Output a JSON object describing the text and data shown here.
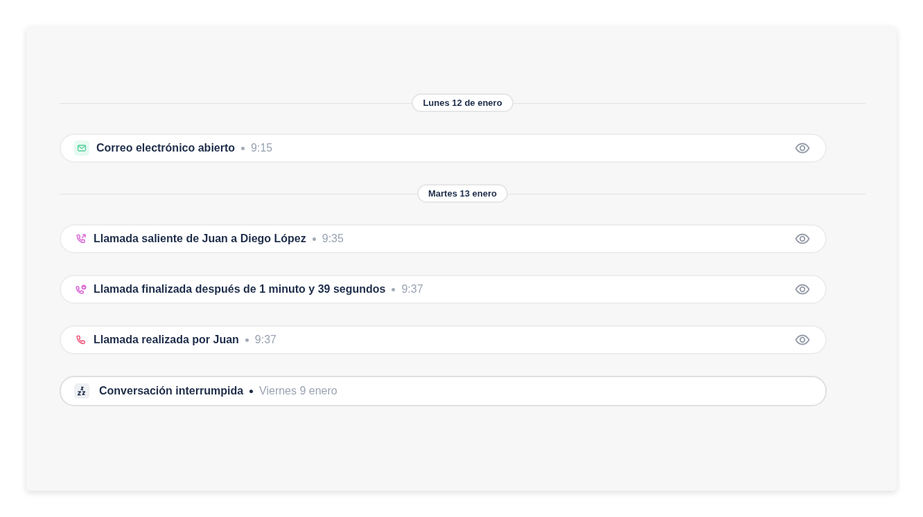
{
  "timeline": [
    {
      "kind": "date",
      "label": "Lunes 12 de enero"
    },
    {
      "kind": "email",
      "title": "Correo electrónico abierto",
      "time": "9:15",
      "viewable": true
    },
    {
      "kind": "date",
      "label": "Martes 13 enero"
    },
    {
      "kind": "outgoing",
      "title": "Llamada saliente de Juan a Diego López",
      "time": "9:35",
      "viewable": true
    },
    {
      "kind": "ended",
      "title": "Llamada finalizada después de 1 minuto y 39 segundos",
      "time": "9:37",
      "viewable": true
    },
    {
      "kind": "call",
      "title": "Llamada realizada por Juan",
      "time": "9:37",
      "viewable": true
    },
    {
      "kind": "interrupted",
      "title": "Conversación interrumpida",
      "time": "Viernes 9 enero",
      "viewable": false
    }
  ]
}
